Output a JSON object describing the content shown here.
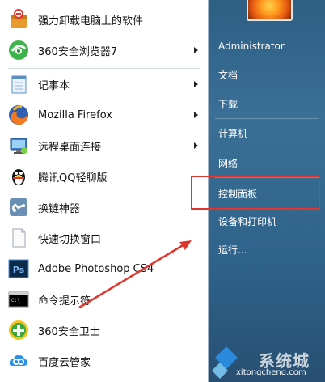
{
  "left_menu": {
    "items": [
      {
        "label": "强力卸载电脑上的软件",
        "icon": "uninstall-box-icon",
        "has_submenu": false
      },
      {
        "label": "360安全浏览器7",
        "icon": "360-browser-icon",
        "has_submenu": true
      },
      {
        "label": "记事本",
        "icon": "notepad-icon",
        "has_submenu": true
      },
      {
        "label": "Mozilla Firefox",
        "icon": "firefox-icon",
        "has_submenu": true
      },
      {
        "label": "远程桌面连接",
        "icon": "remote-desktop-icon",
        "has_submenu": true
      },
      {
        "label": "腾讯QQ轻聊版",
        "icon": "qq-penguin-icon",
        "has_submenu": false
      },
      {
        "label": "换链神器",
        "icon": "link-tool-icon",
        "has_submenu": false
      },
      {
        "label": "快速切换窗口",
        "icon": "blank-document-icon",
        "has_submenu": false
      },
      {
        "label": "Adobe Photoshop CS4",
        "icon": "photoshop-icon",
        "has_submenu": false
      },
      {
        "label": "命令提示符",
        "icon": "command-prompt-icon",
        "has_submenu": false
      },
      {
        "label": "360安全卫士",
        "icon": "360-safeguard-icon",
        "has_submenu": false
      },
      {
        "label": "百度云管家",
        "icon": "baidu-cloud-icon",
        "has_submenu": false
      }
    ]
  },
  "right_menu": {
    "user_name": "Administrator",
    "items": [
      "文档",
      "下载",
      "计算机",
      "网络",
      "控制面板",
      "设备和打印机",
      "运行..."
    ],
    "highlighted": "控制面板"
  },
  "watermark": {
    "text": "系统城",
    "url": "xitongcheng.com"
  },
  "colors": {
    "highlight_box": "#e0352b",
    "right_panel": "#2e5f85",
    "annotation_arrow": "#e0352b"
  }
}
